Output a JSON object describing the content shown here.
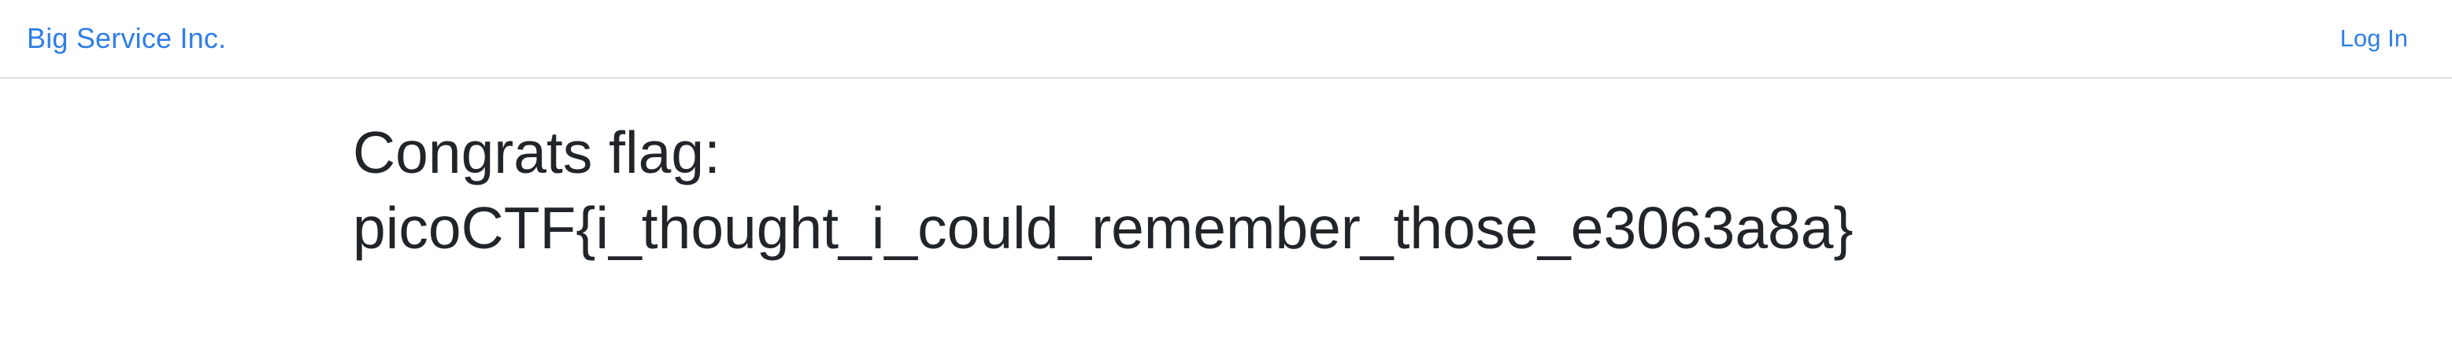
{
  "navbar": {
    "brand": "Big Service Inc.",
    "login_label": "Log In"
  },
  "main": {
    "heading_line1": "Congrats flag:",
    "heading_line2": "picoCTF{i_thought_i_could_remember_those_e3063a8a}"
  },
  "colors": {
    "link": "#2f7ee6",
    "text": "#212529",
    "divider": "#dee2e6",
    "background": "#ffffff"
  }
}
